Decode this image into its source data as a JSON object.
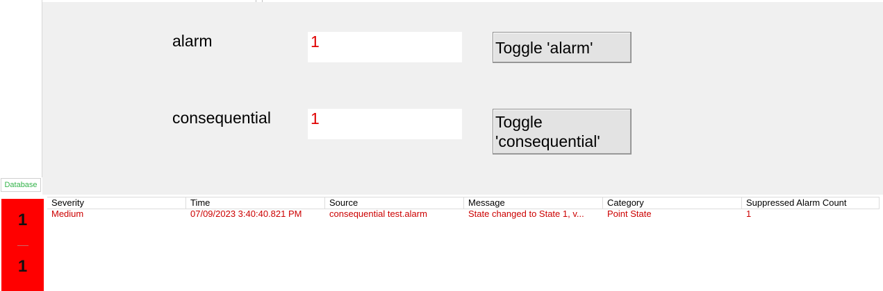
{
  "sidebar": {
    "database_tab": "Database"
  },
  "fields": [
    {
      "label": "alarm",
      "value": "1",
      "button_label": "Toggle 'alarm'"
    },
    {
      "label": "consequential",
      "value": "1",
      "button_label": "Toggle 'consequential'"
    }
  ],
  "counter": {
    "top": "1",
    "bottom": "1",
    "color": "#ff0000"
  },
  "alarm_table": {
    "columns": [
      "Severity",
      "Time",
      "Source",
      "Message",
      "Category",
      "Suppressed Alarm Count"
    ],
    "rows": [
      [
        "Medium",
        "07/09/2023 3:40:40.821 PM",
        "consequential test.alarm",
        "State changed to State 1, v...",
        "Point State",
        "1"
      ]
    ],
    "row_color": "#cc0000"
  },
  "colors": {
    "panel_bg": "#f0f0f0",
    "value_text": "#e00000",
    "database_tab_text": "#33b34a"
  }
}
